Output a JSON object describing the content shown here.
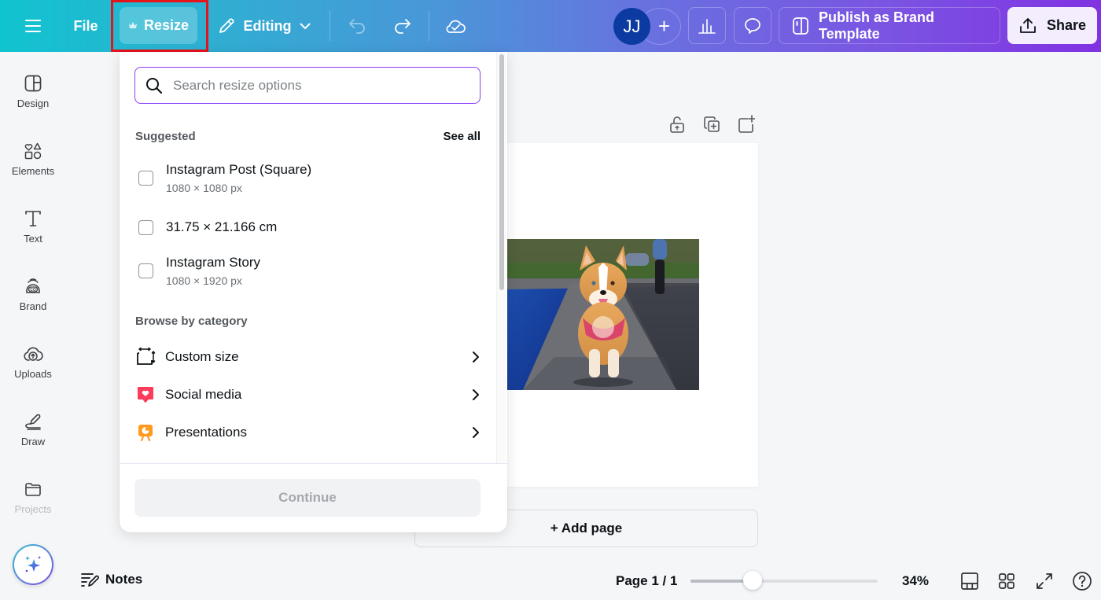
{
  "topbar": {
    "menu_icon": "hamburger-icon",
    "file_label": "File",
    "resize_label": "Resize",
    "resize_badge_icon": "crown-icon",
    "editing_label": "Editing",
    "undo_icon": "undo-icon",
    "redo_icon": "redo-icon",
    "save_status_icon": "cloud-check-icon",
    "avatar_initials": "JJ",
    "add_collaborator": "+",
    "insights_icon": "bar-chart-icon",
    "comments_icon": "comment-icon",
    "publish_label": "Publish as Brand Template",
    "share_label": "Share"
  },
  "sidebar": {
    "items": [
      {
        "label": "Design",
        "icon": "design-icon"
      },
      {
        "label": "Elements",
        "icon": "elements-icon"
      },
      {
        "label": "Text",
        "icon": "text-icon"
      },
      {
        "label": "Brand",
        "icon": "brand-icon"
      },
      {
        "label": "Uploads",
        "icon": "uploads-icon"
      },
      {
        "label": "Draw",
        "icon": "draw-icon"
      },
      {
        "label": "Projects",
        "icon": "projects-icon"
      }
    ],
    "magic_icon": "sparkles-icon"
  },
  "resize_panel": {
    "search_placeholder": "Search resize options",
    "search_value": "",
    "suggested_heading": "Suggested",
    "see_all_label": "See all",
    "suggested": [
      {
        "title": "Instagram Post (Square)",
        "subtitle": "1080 × 1080 px",
        "checked": false
      },
      {
        "title": "31.75 × 21.166 cm",
        "subtitle": "",
        "checked": false
      },
      {
        "title": "Instagram Story",
        "subtitle": "1080 × 1920 px",
        "checked": false
      }
    ],
    "browse_heading": "Browse by category",
    "categories": [
      {
        "label": "Custom size",
        "icon": "custom-size-icon"
      },
      {
        "label": "Social media",
        "icon": "social-media-icon",
        "color": "#ff3b5c"
      },
      {
        "label": "Presentations",
        "icon": "presentations-icon",
        "color": "#ff9a1f"
      }
    ],
    "continue_label": "Continue"
  },
  "canvas": {
    "tools": [
      "unlock-icon",
      "duplicate-page-icon",
      "add-page-icon"
    ],
    "image_alt": "Corgi running on a stone path by the water",
    "add_page_label": "+ Add page"
  },
  "bottombar": {
    "notes_label": "Notes",
    "page_label": "Page 1 / 1",
    "zoom_value": 34,
    "zoom_label": "34%",
    "zoom_slider_fraction": 0.33,
    "icons": [
      "thumbnail-view-icon",
      "grid-view-icon",
      "fullscreen-icon",
      "help-icon"
    ]
  },
  "colors": {
    "brand_purple": "#8b3dff",
    "highlight_red": "#e5141a",
    "avatar_blue": "#0b3aa0"
  }
}
